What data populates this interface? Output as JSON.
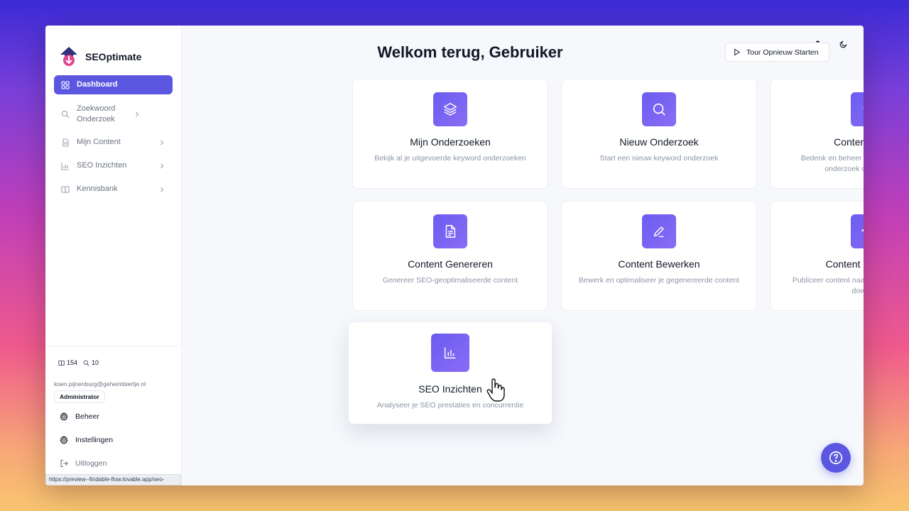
{
  "brand": {
    "name": "SEOptimate"
  },
  "nav": {
    "items": [
      {
        "label": "Dashboard",
        "icon": "grid-icon",
        "active": true
      },
      {
        "label": "Zoekwoord Onderzoek",
        "icon": "search-icon"
      },
      {
        "label": "Mijn Content",
        "icon": "file-icon"
      },
      {
        "label": "SEO Inzichten",
        "icon": "bar-chart-icon"
      },
      {
        "label": "Kennisbank",
        "icon": "book-icon"
      }
    ]
  },
  "stats": {
    "articles": "154",
    "searches": "10"
  },
  "user": {
    "email": "koen.pijnenburg@geheimbiertje.nl",
    "role": "Administrator"
  },
  "side_links": {
    "admin": "Beheer",
    "settings": "Instellingen",
    "logout": "Uitloggen"
  },
  "status_url": "https://preview--findable-flow.lovable.app/seo-insights",
  "header": {
    "title": "Welkom terug, Gebruiker",
    "tour_button": "Tour Opnieuw Starten"
  },
  "cards": [
    {
      "title": "Mijn Onderzoeken",
      "desc": "Bekijk al je uitgevoerde keyword onderzoeken",
      "icon": "layers-icon"
    },
    {
      "title": "Nieuw Onderzoek",
      "desc": "Start een nieuw keyword onderzoek",
      "icon": "search-icon"
    },
    {
      "title": "Content Ideeën",
      "desc": "Bedenk en beheer content ideeën vanuit onderzoek of from scratch",
      "icon": "lightbulb-icon"
    },
    {
      "title": "Content Genereren",
      "desc": "Genereer SEO-geoptimaliseerde content",
      "icon": "document-icon"
    },
    {
      "title": "Content Bewerken",
      "desc": "Bewerk en optimaliseer je gegenereerde content",
      "icon": "pen-icon"
    },
    {
      "title": "Content Publiceren",
      "desc": "Publiceer content naar WordPress, Shopify of download",
      "icon": "send-icon"
    },
    {
      "title": "SEO Inzichten",
      "desc": "Analyseer je SEO prestaties en concurrentie",
      "icon": "bar-chart-icon"
    }
  ],
  "colors": {
    "accent": "#5b57e0",
    "text": "#111827",
    "muted": "#8b95a5"
  }
}
